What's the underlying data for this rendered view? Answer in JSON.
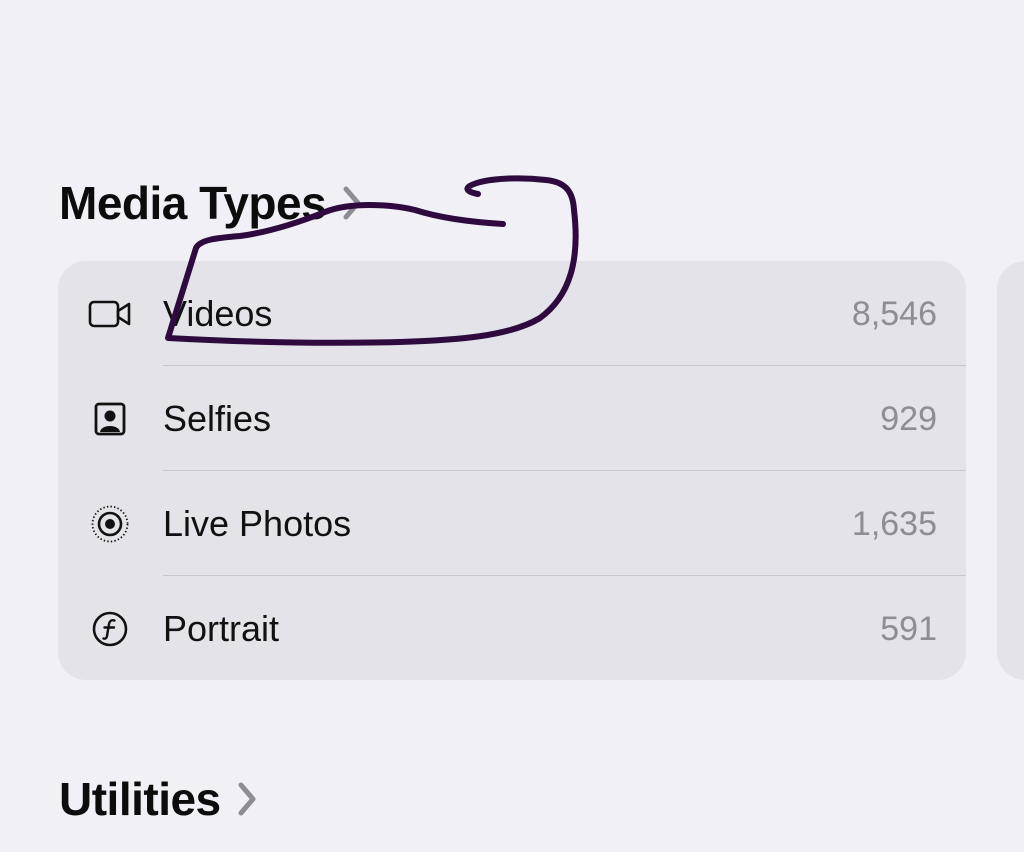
{
  "sections": {
    "media_types": {
      "title": "Media Types",
      "rows": [
        {
          "label": "Videos",
          "count": "8,546",
          "icon": "video-camera-icon"
        },
        {
          "label": "Selfies",
          "count": "929",
          "icon": "selfie-portrait-icon"
        },
        {
          "label": "Live Photos",
          "count": "1,635",
          "icon": "live-photo-icon"
        },
        {
          "label": "Portrait",
          "count": "591",
          "icon": "portrait-f-icon"
        }
      ]
    },
    "utilities": {
      "title": "Utilities"
    }
  },
  "colors": {
    "background": "#f2f0f7",
    "card": "#e4e3ea",
    "count_text": "#8e8d93",
    "annotation_ink": "#2e0a3f"
  }
}
